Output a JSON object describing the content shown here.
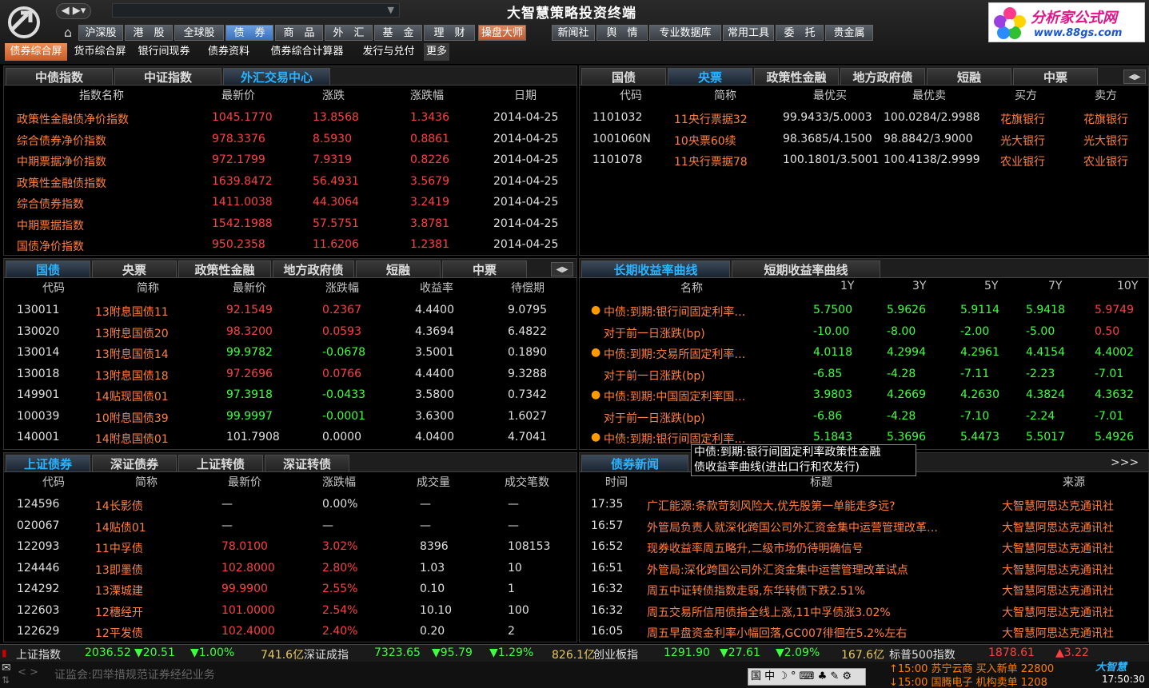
{
  "app_title": "大智慧策略投资终端",
  "nav_arrows": "◀ ▶▾",
  "brand": {
    "name": "分析家公式网",
    "url": "www.88gs.com"
  },
  "main_tabs": [
    "沪深股",
    "港　股",
    "全球股",
    "债　券",
    "商　品",
    "外　汇",
    "基　金",
    "理　财",
    "操盘大师",
    "新闻社",
    "舆　情",
    "专业数据库",
    "常用工具",
    "委　托",
    "贵金属"
  ],
  "sub_tabs": [
    "债券综合屏",
    "货币综合屏",
    "银行间现券",
    "债券资料",
    "债券综合计算器",
    "发行与兑付",
    "更多"
  ],
  "p1": {
    "tabs": [
      "中债指数",
      "中证指数",
      "外汇交易中心"
    ],
    "headers": [
      "指数名称",
      "最新价",
      "涨跌",
      "涨跌幅",
      "日期"
    ],
    "rows": [
      [
        "政策性金融债净价指数",
        "1045.1770",
        "13.8568",
        "1.3436",
        "2014-04-25"
      ],
      [
        "综合债券净价指数",
        "978.3376",
        "8.5930",
        "0.8861",
        "2014-04-25"
      ],
      [
        "中期票据净价指数",
        "972.1799",
        "7.9319",
        "0.8226",
        "2014-04-25"
      ],
      [
        "政策性金融债指数",
        "1639.8472",
        "56.4931",
        "3.5679",
        "2014-04-25"
      ],
      [
        "综合债券指数",
        "1411.0038",
        "44.3064",
        "3.2419",
        "2014-04-25"
      ],
      [
        "中期票据指数",
        "1542.1988",
        "57.5751",
        "3.8781",
        "2014-04-25"
      ],
      [
        "国债净价指数",
        "950.2358",
        "11.6206",
        "1.2381",
        "2014-04-25"
      ]
    ]
  },
  "p2": {
    "tabs": [
      "国债",
      "央票",
      "政策性金融",
      "地方政府债",
      "短融",
      "中票"
    ],
    "headers": [
      "代码",
      "简称",
      "最优买",
      "最优卖",
      "买方",
      "卖方"
    ],
    "rows": [
      [
        "1101032",
        "11央行票据32",
        "99.9433/5.0003",
        "100.0284/2.9988",
        "花旗银行",
        "花旗银行"
      ],
      [
        "1001060N",
        "10央票60续",
        "98.3685/4.1500",
        "98.8842/3.9000",
        "光大银行",
        "光大银行"
      ],
      [
        "1101078",
        "11央行票据78",
        "100.1801/3.5001",
        "100.4138/2.9999",
        "农业银行",
        "农业银行"
      ]
    ]
  },
  "p3": {
    "tabs": [
      "国债",
      "央票",
      "政策性金融",
      "地方政府债",
      "短融",
      "中票"
    ],
    "headers": [
      "代码",
      "简称",
      "最新价",
      "涨跌幅",
      "收益率",
      "待偿期"
    ],
    "rows": [
      [
        "130011",
        "13附息国债11",
        "92.1549",
        "0.2367",
        "4.4400",
        "9.0795"
      ],
      [
        "130020",
        "13附息国债20",
        "98.3200",
        "0.0593",
        "4.3694",
        "6.4822"
      ],
      [
        "130014",
        "13附息国债14",
        "99.9782",
        "-0.0678",
        "3.5001",
        "0.1890"
      ],
      [
        "130018",
        "13附息国债18",
        "97.2696",
        "0.0766",
        "4.4400",
        "9.3288"
      ],
      [
        "149901",
        "14贴现国债01",
        "97.3918",
        "-0.0433",
        "3.5800",
        "0.7342"
      ],
      [
        "100039",
        "10附息国债39",
        "99.9997",
        "-0.0001",
        "3.6300",
        "1.6027"
      ],
      [
        "140001",
        "14附息国债01",
        "101.7908",
        "0.0000",
        "4.0400",
        "4.7041"
      ]
    ]
  },
  "p4": {
    "tabs": [
      "长期收益率曲线",
      "短期收益率曲线"
    ],
    "headers": [
      "名称",
      "1Y",
      "3Y",
      "5Y",
      "7Y",
      "10Y"
    ],
    "rows": [
      [
        "中债:到期:银行间固定利率…",
        "5.7500",
        "5.9626",
        "5.9114",
        "5.9418",
        "5.9749"
      ],
      [
        "对于前一日涨跌(bp)",
        "-10.00",
        "-8.00",
        "-2.00",
        "-5.00",
        "0.50"
      ],
      [
        "中债:到期:交易所固定利率…",
        "4.0118",
        "4.2994",
        "4.2961",
        "4.4154",
        "4.4002"
      ],
      [
        "对于前一日涨跌(bp)",
        "-6.85",
        "-4.28",
        "-7.11",
        "-2.23",
        "-7.01"
      ],
      [
        "中债:到期:中国固定利率国…",
        "3.9803",
        "4.2669",
        "4.2630",
        "4.3824",
        "4.3632"
      ],
      [
        "对于前一日涨跌(bp)",
        "-6.86",
        "-4.28",
        "-7.10",
        "-2.24",
        "-7.01"
      ],
      [
        "中债:到期:银行间固定利率…",
        "5.1843",
        "5.3696",
        "5.4473",
        "5.5017",
        "5.4926"
      ]
    ],
    "tooltip": [
      "中债:到期:银行间固定利率政策性金融",
      "债收益率曲线(进出口行和农发行)"
    ]
  },
  "p5": {
    "tabs": [
      "上证债券",
      "深证债券",
      "上证转债",
      "深证转债"
    ],
    "headers": [
      "代码",
      "简称",
      "最新价",
      "涨跌幅",
      "成交量",
      "成交笔数"
    ],
    "rows": [
      [
        "124596",
        "14长影债",
        "—",
        "0.00%",
        "—",
        "—"
      ],
      [
        "020067",
        "14贴债01",
        "—",
        "—",
        "—",
        "—"
      ],
      [
        "122093",
        "11中孚债",
        "78.0100",
        "3.02%",
        "8396",
        "108153"
      ],
      [
        "124446",
        "13即墨债",
        "102.8000",
        "2.80%",
        "1.03",
        "10"
      ],
      [
        "124292",
        "13溧城建",
        "99.9900",
        "2.55%",
        "0.10",
        "1"
      ],
      [
        "122603",
        "12穗经开",
        "101.0000",
        "2.54%",
        "10.10",
        "100"
      ],
      [
        "122629",
        "12平发债",
        "102.4000",
        "2.40%",
        "0.20",
        "2"
      ]
    ]
  },
  "p6": {
    "tabs": [
      "债券新闻"
    ],
    "more": ">>>",
    "headers": [
      "时间",
      "标题",
      "来源"
    ],
    "rows": [
      [
        "17:35",
        "广汇能源:条款苛刻风险大,优先股第一单能走多远?",
        "大智慧阿思达克通讯社"
      ],
      [
        "16:57",
        "外管局负责人就深化跨国公司外汇资金集中运营管理改革…",
        "大智慧阿思达克通讯社"
      ],
      [
        "16:52",
        "现券收益率周五略升,二级市场仍待明确信号",
        "大智慧阿思达克通讯社"
      ],
      [
        "16:51",
        "外管局:深化跨国公司外汇资金集中运营管理改革试点",
        "大智慧阿思达克通讯社"
      ],
      [
        "16:32",
        "周五中证转债指数走弱,东华转债下跌2.51%",
        "大智慧阿思达克通讯社"
      ],
      [
        "16:32",
        "周五交易所信用债指全线上涨,11中孚债涨3.02%",
        "大智慧阿思达克通讯社"
      ],
      [
        "16:05",
        "周五早盘资金利率小幅回落,GC007徘徊在5.2%左右",
        "大智慧阿思达克通讯社"
      ]
    ]
  },
  "ticker": {
    "sh_name": "上证指数",
    "sh_val": "2036.52",
    "sh_chg": "▼20.51",
    "sh_pct": "▼1.00%",
    "sh_amt": "741.6亿",
    "sz_name": "深证成指",
    "sz_val": "7323.65",
    "sz_chg": "▼95.79",
    "sz_pct": "▼1.29%",
    "sz_amt": "826.1亿",
    "cy_name": "创业板指",
    "cy_val": "1291.90",
    "cy_chg": "▼27.61",
    "cy_pct": "▼2.09%",
    "cy_amt": "167.6亿",
    "sp_name": "标普500指数",
    "sp_val": "1878.61",
    "sp_chg": "▲3.22"
  },
  "status": {
    "news": "证监会:四举措规范证券经纪业务",
    "trade1": "↑15:00 苏宁云商 买入新单 22800",
    "trade2": "↓15:00 国腾电子 机构卖单 1208",
    "time": "17:50:30",
    "tray": "国 中 ☽ ° ⌨ ♣ ✎ ⚙",
    "logo": "大智慧"
  }
}
